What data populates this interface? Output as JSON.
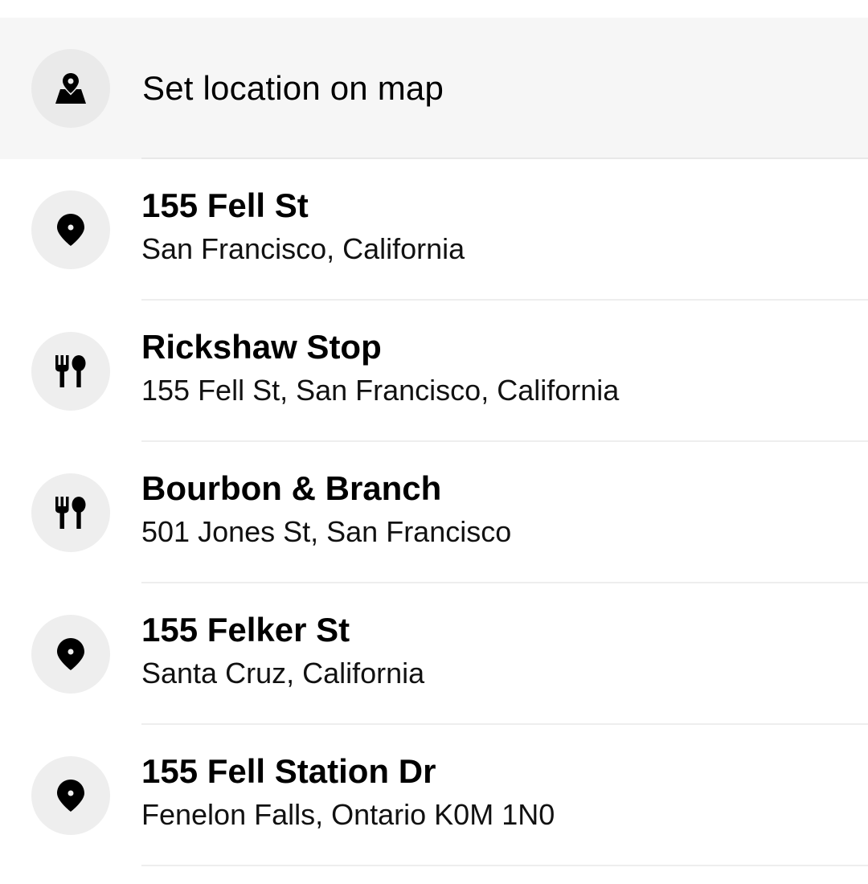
{
  "set_location": {
    "label": "Set location on map",
    "icon": "map-pin-icon"
  },
  "suggestions": [
    {
      "title": "155 Fell St",
      "subtitle": "San Francisco, California",
      "icon": "location-pin-icon"
    },
    {
      "title": "Rickshaw Stop",
      "subtitle": "155 Fell St, San Francisco, California",
      "icon": "restaurant-icon"
    },
    {
      "title": "Bourbon & Branch",
      "subtitle": "501 Jones St, San Francisco",
      "icon": "restaurant-icon"
    },
    {
      "title": "155 Felker St",
      "subtitle": "Santa Cruz, California",
      "icon": "location-pin-icon"
    },
    {
      "title": "155 Fell Station Dr",
      "subtitle": "Fenelon Falls, Ontario K0M 1N0",
      "icon": "location-pin-icon"
    }
  ],
  "colors": {
    "highlight_row": "#f6f6f6",
    "icon_circle": "#eeeeee",
    "divider": "#eeeeee",
    "text": "#000000"
  }
}
